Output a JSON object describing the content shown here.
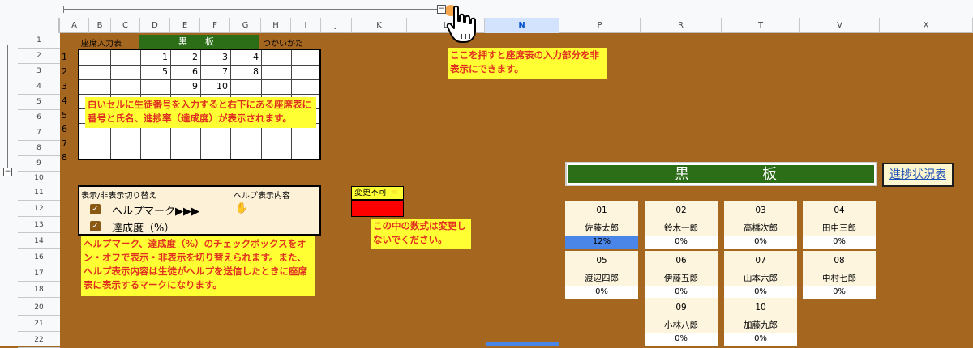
{
  "columns": [
    "A",
    "B",
    "C",
    "D",
    "E",
    "F",
    "G",
    "H",
    "I",
    "J",
    "K",
    "L",
    "N",
    "P",
    "R",
    "T",
    "V",
    "X"
  ],
  "selected_column": "N",
  "rows": [
    "1",
    "2",
    "3",
    "4",
    "5",
    "6",
    "7",
    "8",
    "9",
    "10",
    "11",
    "12",
    "13",
    "14",
    "16",
    "17",
    "18",
    "20",
    "21",
    "22"
  ],
  "collapse_symbol": "−",
  "seat_input": {
    "title": "座席入力表",
    "blackboard_header": "黒　　板",
    "howto": "つかいかた",
    "row_numbers": [
      "1",
      "2",
      "3",
      "4",
      "5",
      "6",
      "7",
      "8"
    ],
    "cells": {
      "r1": [
        "1",
        "2",
        "3",
        "4"
      ],
      "r2": [
        "5",
        "6",
        "7",
        "8"
      ],
      "r3": [
        "9",
        "10"
      ]
    }
  },
  "notes": {
    "seat_instruction": "白いセルに生徒番号を入力すると右下にある座席表に番号と氏名、進捗率（達成度）が表示されます。",
    "hide_instruction": "ここを押すと座席表の入力部分を非表示にできます。",
    "formula_instruction": "この中の数式は変更しないでください。",
    "toggle_instruction": "ヘルプマーク、達成度（%）のチェックボックスをオン・オフで表示・非表示を切り替えられます。また、ヘルプ表示内容は生徒がヘルプを送信したときに座席表に表示するマークになります。"
  },
  "toggle_panel": {
    "title": "表示/非表示切り替え",
    "help_display_label": "ヘルプ表示内容",
    "help_mark_label": "ヘルプマーク▶▶▶",
    "achievement_label": "達成度（%）",
    "help_mark_checked": true,
    "achievement_checked": true
  },
  "formula_warning": "変更不可",
  "blackboard": {
    "label": "黒　　　　　板"
  },
  "progress_link": "進捗状況表",
  "seat_cards": [
    {
      "no": "01",
      "name": "佐藤太郎",
      "pct": "12%",
      "selected": true
    },
    {
      "no": "02",
      "name": "鈴木一郎",
      "pct": "0%"
    },
    {
      "no": "03",
      "name": "高橋次郎",
      "pct": "0%"
    },
    {
      "no": "04",
      "name": "田中三郎",
      "pct": "0%"
    },
    {
      "no": "05",
      "name": "渡辺四郎",
      "pct": "0%"
    },
    {
      "no": "06",
      "name": "伊藤五郎",
      "pct": "0%"
    },
    {
      "no": "07",
      "name": "山本六郎",
      "pct": "0%"
    },
    {
      "no": "08",
      "name": "中村七郎",
      "pct": "0%"
    },
    {
      "no": "09",
      "name": "小林八郎",
      "pct": "0%"
    },
    {
      "no": "10",
      "name": "加藤九郎",
      "pct": "0%"
    }
  ],
  "colors": {
    "background": "#a5661f",
    "blackboard": "#2c6e18",
    "note": "#ffff33",
    "note_text": "#e03020",
    "selection": "#4a86e8"
  }
}
